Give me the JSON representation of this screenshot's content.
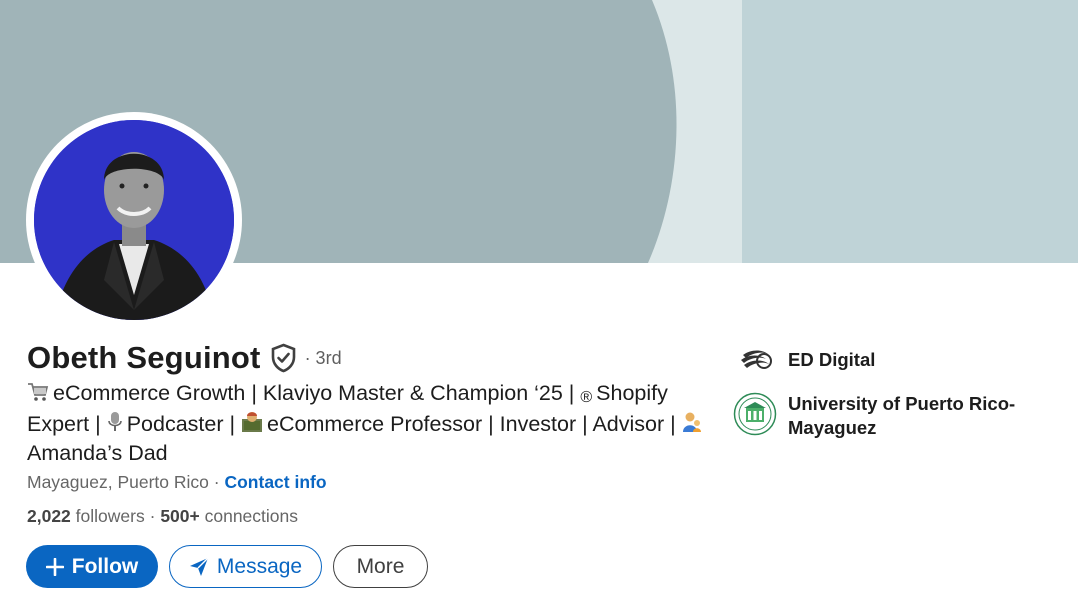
{
  "profile": {
    "name": "Obeth Seguinot",
    "degree": "· 3rd",
    "headline": {
      "segments": [
        {
          "icon": "shopping-cart-icon",
          "text": "eCommerce Growth | Klaviyo Master & Champion ‘25 |"
        },
        {
          "icon": "registered-icon",
          "text": "Shopify Expert |"
        },
        {
          "icon": "microphone-icon",
          "text": "Podcaster |"
        },
        {
          "icon": "teacher-icon",
          "text": "eCommerce Professor | Investor | Advisor |"
        },
        {
          "icon": "father-icon",
          "text": "Amanda’s Dad"
        }
      ]
    },
    "location": "Mayaguez, Puerto Rico",
    "location_sep": " · ",
    "contact_label": "Contact info",
    "followers_count": "2,022",
    "followers_label": "followers",
    "connections_sep": " · ",
    "connections_count": "500+",
    "connections_label": "connections"
  },
  "actions": {
    "follow_label": "Follow",
    "message_label": "Message",
    "more_label": "More"
  },
  "sidebar": {
    "company": {
      "label": "ED Digital",
      "icon": "company-logo-icon"
    },
    "school": {
      "label_line1": "University of Puerto Rico-",
      "label_line2": "Mayaguez",
      "icon": "university-seal-icon"
    }
  },
  "colors": {
    "accent": "#0a66c2",
    "banner_dark": "#a0b4b8",
    "banner_light": "#bfd3d7",
    "avatar_bg": "#2f33c8"
  }
}
